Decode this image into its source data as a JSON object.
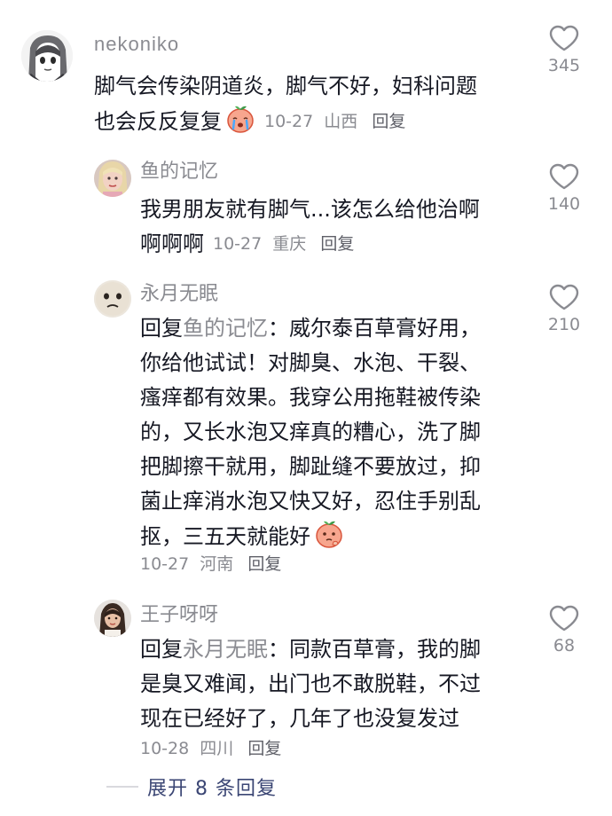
{
  "comments": [
    {
      "username": "nekoniko",
      "lines": [
        "脚气会传染阴道炎，脚气不好，妇科问题",
        "也会反反复复"
      ],
      "emoji": "crying-peach-emoji",
      "date": "10-27",
      "location": "山西",
      "reply_label": "回复",
      "likes": "345",
      "avatar_icon": "anime-girl-avatar"
    },
    {
      "username": "鱼的记忆",
      "lines": [
        "我男朋友就有脚气...该怎么给他治啊",
        "啊啊啊"
      ],
      "date": "10-27",
      "location": "重庆",
      "reply_label": "回复",
      "likes": "140",
      "avatar_icon": "blonde-person-avatar"
    },
    {
      "username": "永月无眠",
      "reply_prefix": "回复",
      "reply_target": "鱼的记忆",
      "lines": [
        "：威尔泰百草膏好用，",
        "你给他试试！对脚臭、水泡、干裂、",
        "瘙痒都有效果。我穿公用拖鞋被传染",
        "的，又长水泡又痒真的糟心，洗了脚",
        "把脚擦干就用，脚趾缝不要放过，抑",
        "菌止痒消水泡又快又好，忍住手别乱",
        "抠，三五天就能好"
      ],
      "emoji": "thinking-peach-emoji",
      "date": "10-27",
      "location": "河南",
      "reply_label": "回复",
      "likes": "210",
      "avatar_icon": "worried-face-avatar"
    },
    {
      "username": "王子呀呀",
      "reply_prefix": "回复",
      "reply_target": "永月无眠",
      "lines": [
        "：同款百草膏，我的脚",
        "是臭又难闻，出门也不敢脱鞋，不过",
        "现在已经好了，几年了也没复发过"
      ],
      "date": "10-28",
      "location": "四川",
      "reply_label": "回复",
      "likes": "68",
      "avatar_icon": "girl-photo-avatar"
    }
  ],
  "expand": {
    "label": "展开 8 条回复"
  },
  "colors": {
    "text": "#161823",
    "secondary": "#8a8b91",
    "link": "#3b4674",
    "heart_outline": "#8a8b91"
  }
}
